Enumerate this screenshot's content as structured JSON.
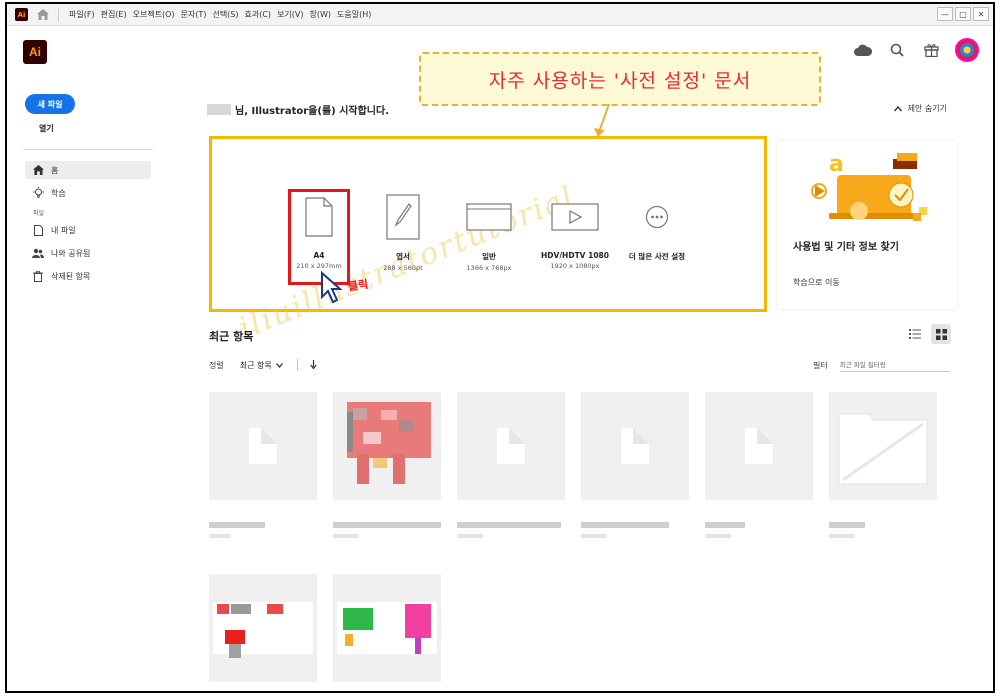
{
  "menu": {
    "app_badge": "Ai",
    "items": [
      "파일(F)",
      "편집(E)",
      "오브젝트(O)",
      "문자(T)",
      "선택(S)",
      "효과(C)",
      "보기(V)",
      "창(W)",
      "도움말(H)"
    ],
    "window_buttons": [
      "—",
      "□",
      "✕"
    ]
  },
  "header": {
    "logo": "Ai",
    "icons": [
      "cloud-icon",
      "search-icon",
      "gift-icon",
      "avatar"
    ]
  },
  "annotation": {
    "banner_text": "자주 사용하는 '사전 설정' 문서",
    "click_label": "클릭",
    "watermark": "iliuillustratortutorial"
  },
  "sidebar": {
    "new_file": "새 파일",
    "open": "열기",
    "items": [
      {
        "label": "홈",
        "icon": "home-icon",
        "active": true
      },
      {
        "label": "학습",
        "icon": "bulb-icon",
        "active": false
      }
    ],
    "section_label": "파일",
    "file_items": [
      {
        "label": "내 파일",
        "icon": "file-icon"
      },
      {
        "label": "나와 공유됨",
        "icon": "people-icon"
      },
      {
        "label": "삭제된 항목",
        "icon": "trash-icon"
      }
    ]
  },
  "welcome": {
    "text": "님, Illustrator을(를) 시작합니다.",
    "hide_suggestions": "제안 숨기기"
  },
  "presets": [
    {
      "name": "A4",
      "size": "210 x 297mm",
      "icon": "document-icon"
    },
    {
      "name": "엽서",
      "size": "288 x 560pt",
      "icon": "postcard-icon"
    },
    {
      "name": "일반",
      "size": "1366 x 768px",
      "icon": "web-icon"
    },
    {
      "name": "HDV/HDTV 1080",
      "size": "1920 x 1080px",
      "icon": "video-icon"
    },
    {
      "name": "더 많은 사전 설정",
      "size": "",
      "icon": "more-icon"
    }
  ],
  "learn": {
    "title": "사용법 및 기타 정보 찾기",
    "link": "학습으로 이동"
  },
  "recent": {
    "title": "최근 항목",
    "sort_label": "정렬",
    "sort_value": "최근 항목",
    "filter_label": "필터",
    "filter_placeholder": "최근 파일 필터링"
  },
  "colors": {
    "accent": "#1473e6",
    "highlight": "#e8161b",
    "preset_border": "#f5b700",
    "banner_text": "#e8283f"
  }
}
